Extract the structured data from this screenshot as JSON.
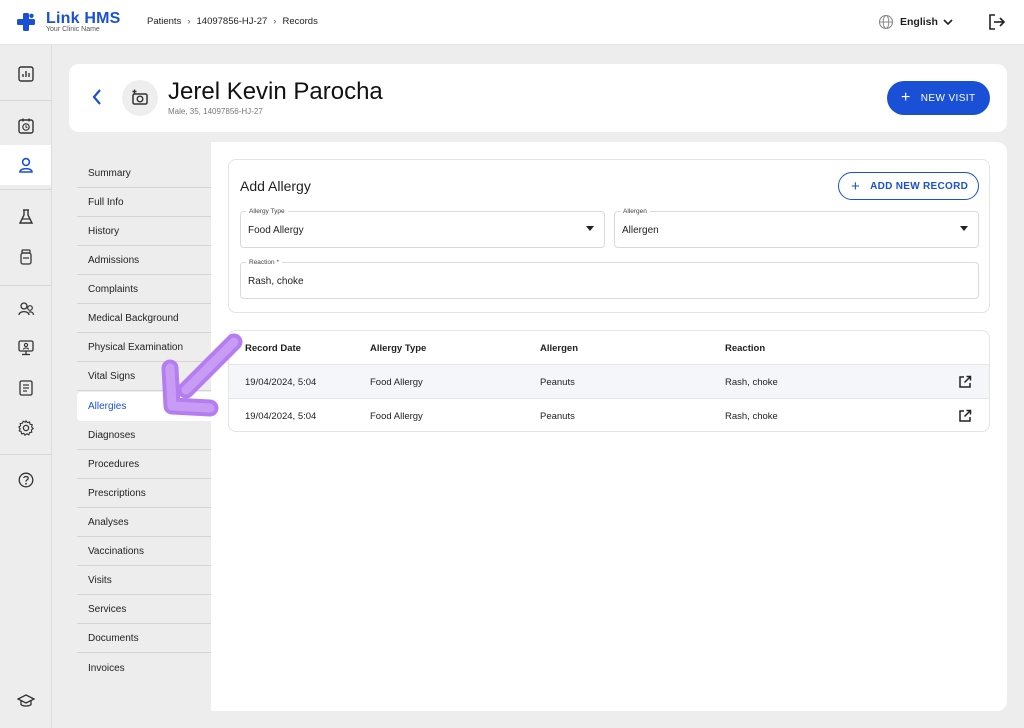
{
  "brand": {
    "name": "Link HMS",
    "subtitle": "Your Clinic Name",
    "accent": "#1a50d6"
  },
  "breadcrumb": {
    "items": [
      "Patients",
      "14097856-HJ-27",
      "Records"
    ]
  },
  "language": {
    "label": "English"
  },
  "rail": {
    "icons": [
      "dashboard-icon",
      "calendar-clock-icon",
      "patient-icon",
      "lab-flask-icon",
      "medication-bottle-icon",
      "staff-icon",
      "monitor-icon",
      "report-icon",
      "settings-icon",
      "help-icon",
      "education-icon"
    ]
  },
  "patient": {
    "name": "Jerel Kevin Parocha",
    "meta": "Male, 35, 14097856-HJ-27"
  },
  "actions": {
    "new_visit": "NEW VISIT",
    "add_new_record": "ADD NEW RECORD"
  },
  "nav": {
    "active": "Allergies",
    "items": [
      "Summary",
      "Full Info",
      "History",
      "Admissions",
      "Complaints",
      "Medical Background",
      "Physical Examination",
      "Vital Signs",
      "Allergies",
      "Diagnoses",
      "Procedures",
      "Prescriptions",
      "Analyses",
      "Vaccinations",
      "Visits",
      "Services",
      "Documents",
      "Invoices"
    ]
  },
  "form": {
    "title": "Add Allergy",
    "allergy_type": {
      "label": "Allergy Type",
      "value": "Food Allergy"
    },
    "allergen": {
      "label": "Allergen",
      "value": "Allergen"
    },
    "reaction": {
      "label": "Reaction *",
      "value": "Rash, choke"
    }
  },
  "table": {
    "headers": [
      "Record Date",
      "Allergy Type",
      "Allergen",
      "Reaction"
    ],
    "rows": [
      [
        "19/04/2024, 5:04",
        "Food Allergy",
        "Peanuts",
        "Rash, choke"
      ],
      [
        "19/04/2024, 5:04",
        "Food Allergy",
        "Peanuts",
        "Rash, choke"
      ]
    ]
  },
  "annotation": {
    "color": "#b57ef0"
  }
}
